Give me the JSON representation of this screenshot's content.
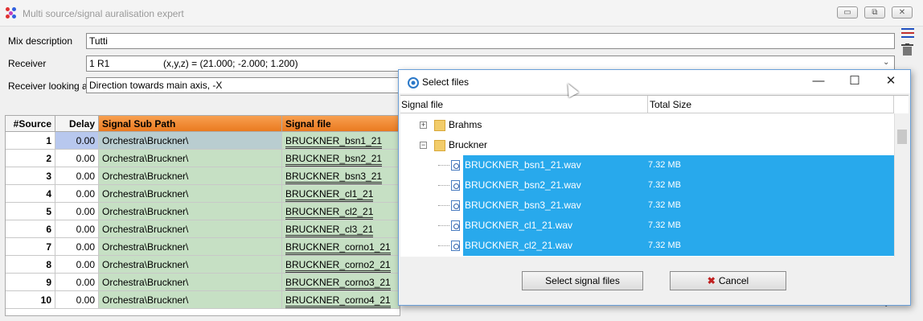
{
  "window": {
    "title": "Multi source/signal auralisation expert",
    "controls": {
      "minimize": "▭",
      "restore": "⧉",
      "close": "✕"
    }
  },
  "form": {
    "mix_label": "Mix description",
    "mix_value": "Tutti",
    "receiver_label": "Receiver",
    "receiver_value": "1 R1                    (x,y,z) = (21.000; -2.000; 1.200)",
    "looking_label": "Receiver looking at",
    "looking_value": "Direction towards main axis, -X"
  },
  "grid": {
    "headers": {
      "source": "#Source",
      "delay": "Delay",
      "path": "Signal Sub Path",
      "file": "Signal file"
    },
    "rows": [
      {
        "source": "1",
        "delay": "0.00",
        "path": "Orchestra\\Bruckner\\",
        "file": "BRUCKNER_bsn1_21"
      },
      {
        "source": "2",
        "delay": "0.00",
        "path": "Orchestra\\Bruckner\\",
        "file": "BRUCKNER_bsn2_21"
      },
      {
        "source": "3",
        "delay": "0.00",
        "path": "Orchestra\\Bruckner\\",
        "file": "BRUCKNER_bsn3_21"
      },
      {
        "source": "4",
        "delay": "0.00",
        "path": "Orchestra\\Bruckner\\",
        "file": "BRUCKNER_cl1_21"
      },
      {
        "source": "5",
        "delay": "0.00",
        "path": "Orchestra\\Bruckner\\",
        "file": "BRUCKNER_cl2_21"
      },
      {
        "source": "6",
        "delay": "0.00",
        "path": "Orchestra\\Bruckner\\",
        "file": "BRUCKNER_cl3_21"
      },
      {
        "source": "7",
        "delay": "0.00",
        "path": "Orchestra\\Bruckner\\",
        "file": "BRUCKNER_corno1_21"
      },
      {
        "source": "8",
        "delay": "0.00",
        "path": "Orchestra\\Bruckner\\",
        "file": "BRUCKNER_corno2_21"
      },
      {
        "source": "9",
        "delay": "0.00",
        "path": "Orchestra\\Bruckner\\",
        "file": "BRUCKNER_corno3_21"
      },
      {
        "source": "10",
        "delay": "0.00",
        "path": "Orchestra\\Bruckner\\",
        "file": "BRUCKNER_corno4_21"
      }
    ]
  },
  "dialog": {
    "title": "Select files",
    "controls": {
      "minimize": "—",
      "maximize": "☐",
      "close": "✕"
    },
    "col_file": "Signal file",
    "col_size": "Total Size",
    "folders": [
      {
        "name": "Brahms",
        "expander": "+"
      },
      {
        "name": "Bruckner",
        "expander": "−"
      }
    ],
    "files": [
      {
        "name": "BRUCKNER_bsn1_21.wav",
        "size": "7.32 MB"
      },
      {
        "name": "BRUCKNER_bsn2_21.wav",
        "size": "7.32 MB"
      },
      {
        "name": "BRUCKNER_bsn3_21.wav",
        "size": "7.32 MB"
      },
      {
        "name": "BRUCKNER_cl1_21.wav",
        "size": "7.32 MB"
      },
      {
        "name": "BRUCKNER_cl2_21.wav",
        "size": "7.32 MB"
      }
    ],
    "select_button": "Select signal files",
    "cancel_button": "Cancel",
    "cancel_icon": "✖"
  },
  "colors": {
    "selection": "#28a9ec",
    "grid_green": "#c6e0c4",
    "header_orange": "#f0802a"
  }
}
